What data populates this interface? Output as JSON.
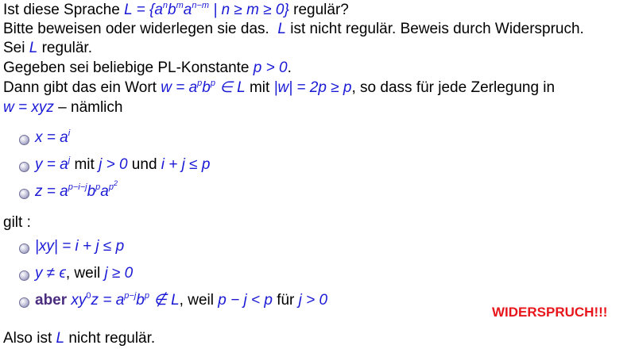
{
  "line1": {
    "t1": "Ist diese Sprache ",
    "m1": "L",
    "m2": " = {a",
    "s1": "n",
    "m3": "b",
    "s2": "m",
    "m4": "a",
    "s3": "n−m",
    "m5": " | n ≥ m ≥ 0}",
    "t2": " regulär?"
  },
  "line2": {
    "t1": "Bitte beweisen oder widerlegen sie das.",
    "m1": "L",
    "t2": " ist nicht regulär. Beweis durch Widerspruch."
  },
  "line3": {
    "t1": "Sei ",
    "m1": "L",
    "t2": " regulär."
  },
  "line4": {
    "t1": "Gegeben sei beliebige PL-Konstante ",
    "m1": "p > 0",
    "t2": "."
  },
  "line5": {
    "t1": "Dann gibt das ein Wort ",
    "m1": "w = a",
    "s1": "p",
    "m2": "b",
    "s2": "p",
    "m3": " ∈ L",
    "t2": " mit ",
    "m4": "|w| = 2p ≥ p",
    "t3": ", so dass für jede Zerlegung in"
  },
  "line6": {
    "m1": "w = xyz",
    "t1": " – nämlich"
  },
  "bullets_a": [
    {
      "m1": "x = a",
      "s1": "i"
    },
    {
      "m1": "y = a",
      "s1": "j",
      "t1": " mit ",
      "m2": "j > 0",
      "t2": " und ",
      "m3": "i + j ≤ p"
    },
    {
      "m1": "z = a",
      "s1": "p−i−j",
      "m2": "b",
      "s2": "p",
      "m3": "a",
      "s3": "p",
      "s4": "2"
    }
  ],
  "gilt": "gilt :",
  "bullets_b": [
    {
      "m1": "|xy| = i + j ≤ p"
    },
    {
      "m1": "y ≠ ϵ",
      "t1": ", weil ",
      "m2": "j ≥ 0"
    },
    {
      "b1": "aber ",
      "m1": "xy",
      "s1": "0",
      "m2": "z = a",
      "s2": "p−j",
      "m3": "b",
      "s3": "p",
      "m4": " ∉ L",
      "t1": ", weil ",
      "m5": "p − j < p",
      "t2": " für ",
      "m6": "j > 0"
    }
  ],
  "widerspruch": "WIDERSPRUCH!!!",
  "last": {
    "t1": "Also ist ",
    "m1": "L",
    "t2": " nicht regulär."
  }
}
